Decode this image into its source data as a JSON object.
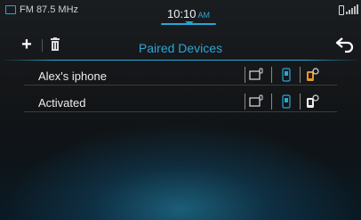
{
  "status": {
    "radio": "FM 87.5 MHz",
    "time": "10:10",
    "ampm": "AM"
  },
  "header": {
    "title": "Paired Devices",
    "add_icon": "plus-icon",
    "delete_icon": "trash-icon",
    "back_icon": "back-arrow-icon"
  },
  "devices": [
    {
      "name": "Alex's iphone",
      "hfp_active": false,
      "a2dp_active": false,
      "settings_active": true
    },
    {
      "name": "Activated",
      "hfp_active": false,
      "a2dp_active": false,
      "settings_active": false
    }
  ],
  "colors": {
    "accent": "#2aa6d6",
    "active_orange": "#e29a2a"
  }
}
